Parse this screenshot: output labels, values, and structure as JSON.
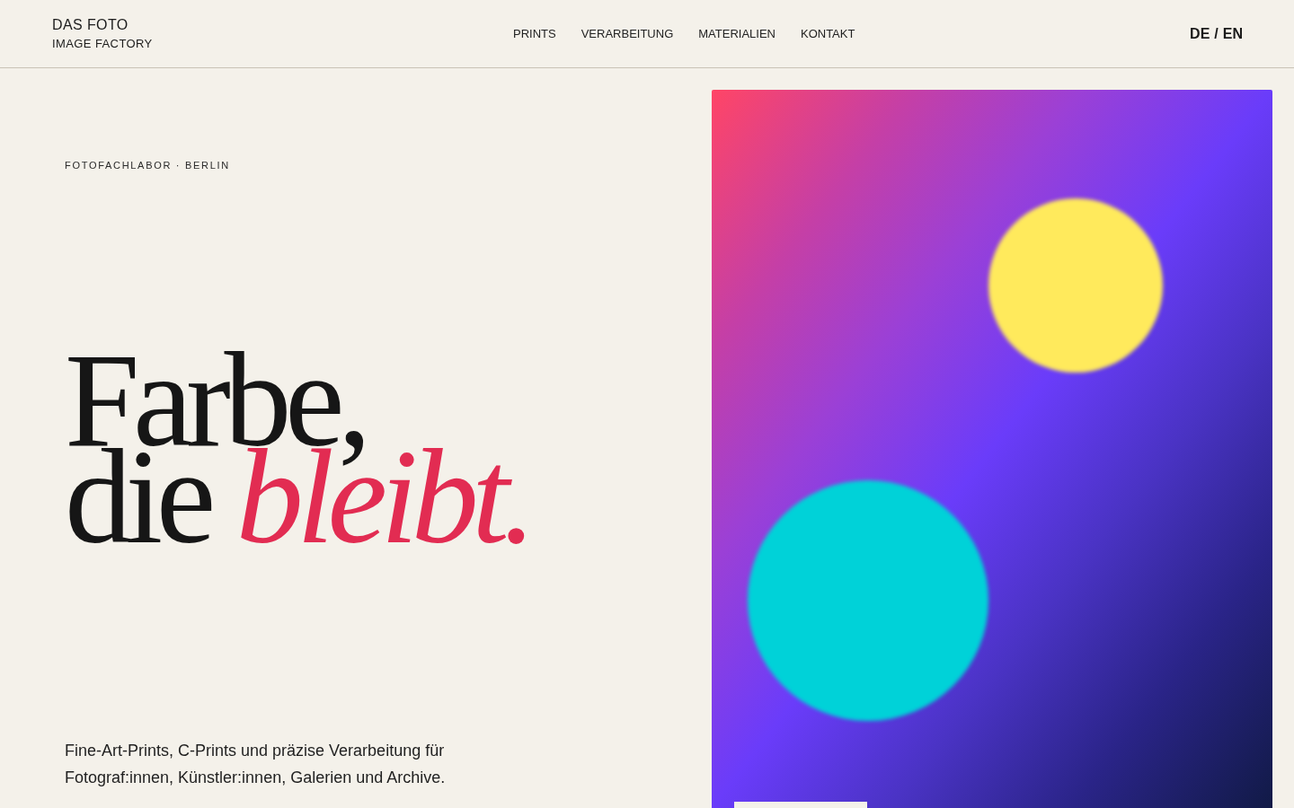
{
  "header": {
    "brand": {
      "name": "DAS FOTO",
      "tagline": "IMAGE FACTORY"
    },
    "nav": [
      "PRINTS",
      "VERARBEITUNG",
      "MATERIALIEN",
      "KONTAKT"
    ],
    "language_switch": {
      "options": [
        "DE",
        "EN"
      ],
      "separator": "/"
    }
  },
  "hero": {
    "eyebrow": "FOTOFACHLABOR · BERLIN",
    "headline": [
      "Farbe,",
      "die *bleibt.*"
    ],
    "intro": "Fine-Art-Prints, C-Prints und präzise Verarbeitung für Fotograf:innen, Künstler:innen, Galerien und Archive.",
    "artwork": {
      "circles": [
        {
          "color": "#ffea5c"
        },
        {
          "color": "#00d2d8"
        }
      ]
    }
  }
}
